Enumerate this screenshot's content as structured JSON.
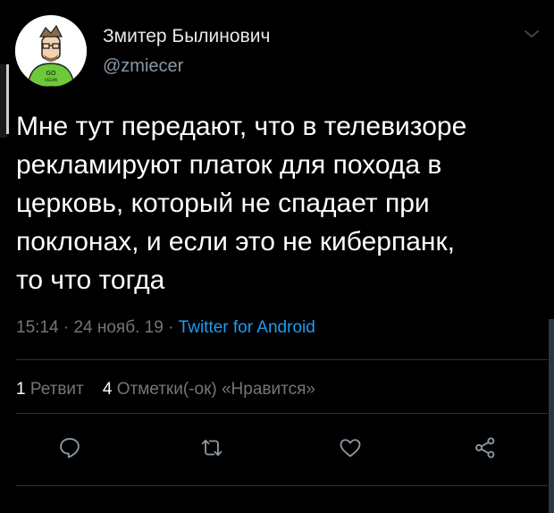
{
  "user": {
    "display_name": "Змитер Былинович",
    "handle": "@zmiecer",
    "avatar_shirt_text": "GO",
    "avatar_shirt_subtext": "VEGAN"
  },
  "tweet": {
    "lines": [
      "Мне тут передают, что в телевизоре",
      "рекламируют платок для похода в",
      "церковь, который не спадает при",
      "поклонах, и если это не киберпанк,",
      "то что тогда"
    ],
    "time": "15:14",
    "date": "24 нояб. 19",
    "separator": "·",
    "source": "Twitter for Android"
  },
  "stats": {
    "retweets_count": "1",
    "retweets_label": "Ретвит",
    "likes_count": "4",
    "likes_label": "Отметки(-ок) «Нравится»"
  },
  "colors": {
    "background": "#000000",
    "text": "#ffffff",
    "secondary": "#71767b",
    "link": "#1d9bf0",
    "divider": "#2f3336"
  },
  "icons": [
    "chevron-down-icon",
    "reply-icon",
    "retweet-icon",
    "like-icon",
    "share-icon"
  ]
}
